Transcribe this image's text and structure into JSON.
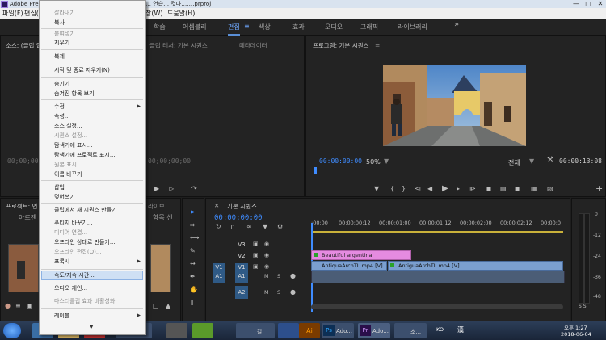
{
  "titlebar": {
    "app": "Adobe Prem",
    "project_fragment": "… 연습… 컷다…….prproj",
    "controls": [
      "—",
      "□",
      "✕"
    ]
  },
  "menubar": {
    "items": [
      "파일(F)",
      "편집(E)",
      "창(W)",
      "도움말(H)"
    ]
  },
  "workspaces": {
    "items": [
      "학습",
      "어셈블리",
      "편집",
      "색상",
      "효과",
      "오디오",
      "그래픽",
      "라이브러리"
    ],
    "active": "편집",
    "more": "»",
    "menu_icon": "≡"
  },
  "source_panel": {
    "title": "소스: (클립 없음)",
    "timecode": "00;00;00;00"
  },
  "middle_tabs": {
    "tab1": "클립 테서: 기본 시퀀스",
    "tab2": "메타데이터"
  },
  "program": {
    "title": "프로그램: 기본 시퀀스",
    "menu_icon": "≡",
    "timecode": "00:00:00:00",
    "zoom": "50%",
    "quality": "전체",
    "duration": "00:00:13:08"
  },
  "project_panel": {
    "title": "프로젝트: 연",
    "bin_name": "아르젠",
    "tab_right": "라이브",
    "item_label": "항목 선"
  },
  "timeline": {
    "title": "기본 시퀀스",
    "timecode": "00:00:00:00",
    "ruler": [
      ":00:00",
      "00:00:00:12",
      "00:00:01:00",
      "00:00:01:12",
      "00:00:02:00",
      "00:00:02:12",
      "00:00:0"
    ],
    "tracks": [
      "V3",
      "V2",
      "V1",
      "A1",
      "A2"
    ],
    "source_patch": [
      "V1",
      "A1"
    ],
    "track_toggles": [
      "M",
      "S"
    ],
    "clips": {
      "title_clip": "Beautiful argentina",
      "video_clip_1": "AntiquaArchTL.mp4 [V]",
      "video_clip_2": "AntiguaArchTL.mp4 [V]"
    }
  },
  "meter": {
    "labels": [
      "0",
      "-12",
      "-24",
      "-36",
      "-48"
    ],
    "bottom": "S  S"
  },
  "context_menu": {
    "items": [
      {
        "label": "잘라내기",
        "enabled": false
      },
      {
        "label": "복사",
        "enabled": true
      },
      {
        "label": "붙여넣기",
        "enabled": false
      },
      {
        "label": "지우기",
        "enabled": true
      },
      {
        "label": "복제",
        "enabled": true
      },
      {
        "label": "시작 및 종료 지우기(N)",
        "enabled": true
      },
      {
        "label": "숨기기",
        "enabled": true
      },
      {
        "label": "숨겨진 항목 보기",
        "enabled": true
      },
      {
        "label": "수정",
        "enabled": true,
        "submenu": true
      },
      {
        "label": "속성...",
        "enabled": true
      },
      {
        "label": "소스 설정...",
        "enabled": true
      },
      {
        "label": "시퀀스 설정...",
        "enabled": false
      },
      {
        "label": "탐색기에 표시...",
        "enabled": true
      },
      {
        "label": "탐색기에 프로젝트 표시...",
        "enabled": true
      },
      {
        "label": "원본 표시...",
        "enabled": false
      },
      {
        "label": "이름 바꾸기",
        "enabled": true
      },
      {
        "label": "삽입",
        "enabled": true
      },
      {
        "label": "덮어쓰기",
        "enabled": true
      },
      {
        "label": "클립에서 새 시퀀스 만들기",
        "enabled": true
      },
      {
        "label": "푸티지 바꾸기...",
        "enabled": true
      },
      {
        "label": "미디어 연결...",
        "enabled": false
      },
      {
        "label": "오프라인 상태로 만들기...",
        "enabled": true
      },
      {
        "label": "오프라인 편집(O)...",
        "enabled": false
      },
      {
        "label": "프록시",
        "enabled": true,
        "submenu": true
      },
      {
        "label": "속도/지속 시간...",
        "enabled": true,
        "highlighted": true
      },
      {
        "label": "오디오 게인...",
        "enabled": true
      },
      {
        "label": "마스터클립 효과 비활성화",
        "enabled": false
      },
      {
        "label": "레이블",
        "enabled": true,
        "submenu": true
      }
    ],
    "more_arrow": "▼"
  },
  "taskbar": {
    "apps": [
      "다",
      "칼",
      "Ado...",
      "Ado...",
      "소..."
    ],
    "tray": {
      "lang": "KO",
      "ime": "漢",
      "time": "오후 1:27",
      "date": "2018-06-04"
    }
  },
  "colors": {
    "accent": "#5a8fd6",
    "timecode_blue": "#3f8cff",
    "title_clip": "#e58be0",
    "video_clip": "#7b9fcf",
    "highlight": "#cfe0f4"
  }
}
